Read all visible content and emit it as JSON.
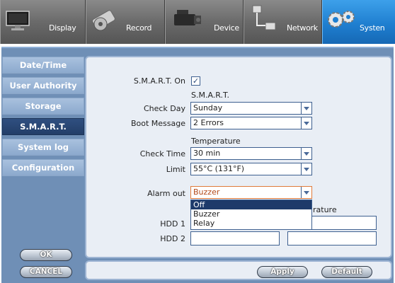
{
  "top_tabs": [
    {
      "label": "Display",
      "icon": "monitor-icon"
    },
    {
      "label": "Record",
      "icon": "film-reel-icon"
    },
    {
      "label": "Device",
      "icon": "camcorder-icon"
    },
    {
      "label": "Network",
      "icon": "network-icon"
    },
    {
      "label": "Systen",
      "icon": "gears-icon",
      "active": true
    }
  ],
  "sidebar": {
    "items": [
      {
        "label": "Date/Time"
      },
      {
        "label": "User Authority"
      },
      {
        "label": "Storage"
      },
      {
        "label": "S.M.A.R.T.",
        "active": true
      },
      {
        "label": "System log"
      },
      {
        "label": "Configuration"
      }
    ],
    "ok_label": "OK",
    "cancel_label": "CANCEL"
  },
  "form": {
    "smart_on_label": "S.M.A.R.T. On",
    "smart_on_checked": true,
    "smart_section_title": "S.M.A.R.T.",
    "check_day_label": "Check Day",
    "check_day_value": "Sunday",
    "boot_message_label": "Boot Message",
    "boot_message_value": "2 Errors",
    "temperature_section_title": "Temperature",
    "check_time_label": "Check Time",
    "check_time_value": "30 min",
    "limit_label": "Limit",
    "limit_value": "55°C (131°F)",
    "alarm_out_label": "Alarm out",
    "alarm_out_value": "Buzzer",
    "alarm_out_options": [
      "Off",
      "Buzzer",
      "Relay"
    ],
    "alarm_out_highlighted": "Off",
    "temperature_column_partial": "rature",
    "hdd1_label": "HDD 1",
    "hdd2_label": "HDD 2"
  },
  "footer": {
    "apply_label": "Apply",
    "default_label": "Default"
  },
  "colors": {
    "active_tab": "#1f7fd0",
    "sidebar_active": "#2f4f80",
    "alarm_focus": "#e07a3a"
  }
}
